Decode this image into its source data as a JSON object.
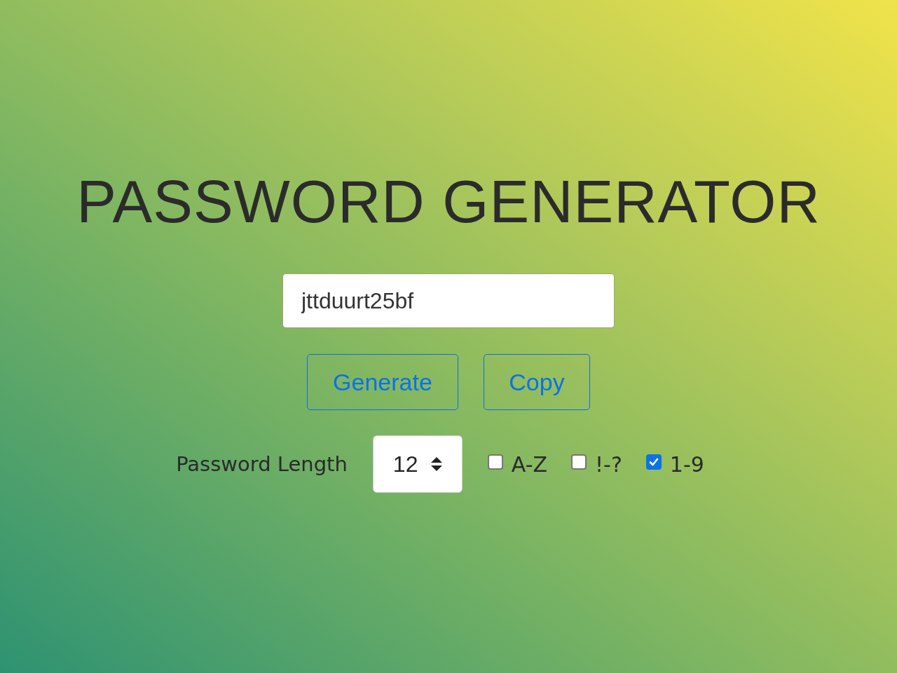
{
  "title": "PASSWORD GENERATOR",
  "password_field": {
    "value": "jttduurt25bf"
  },
  "buttons": [
    {
      "label": "Generate"
    },
    {
      "label": "Copy"
    }
  ],
  "length": {
    "label": "Password Length",
    "value": "12"
  },
  "options": [
    {
      "label": "A-Z",
      "checked": false
    },
    {
      "label": "!-?",
      "checked": false
    },
    {
      "label": "1-9",
      "checked": true
    }
  ]
}
